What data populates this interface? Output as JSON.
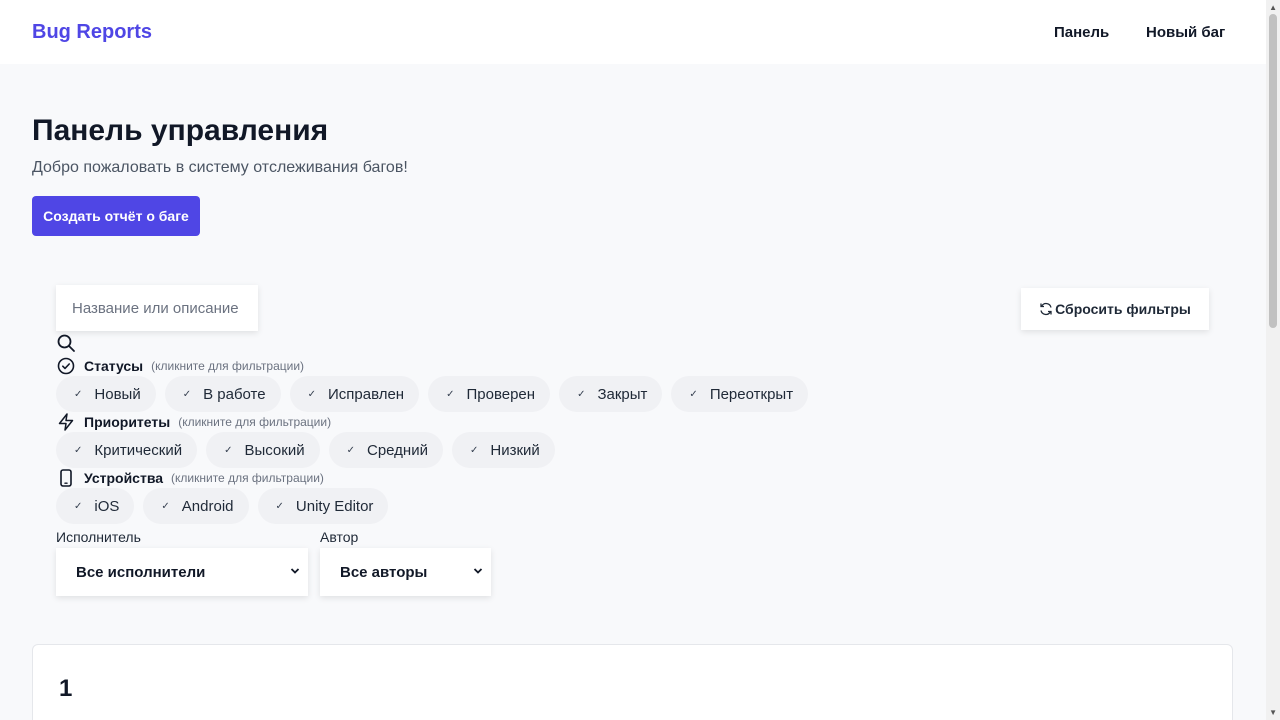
{
  "header": {
    "brand": "Bug Reports",
    "nav": {
      "dashboard": "Панель",
      "new_bug": "Новый баг"
    }
  },
  "main": {
    "title": "Панель управления",
    "subtitle": "Добро пожаловать в систему отслеживания багов!",
    "create_button": "Создать отчёт о баге"
  },
  "filters": {
    "search_placeholder": "Название или описание",
    "search_value": "",
    "reset_label": "Сбросить фильтры",
    "statuses": {
      "title": "Статусы",
      "hint": "(кликните для фильтрации)",
      "items": [
        "Новый",
        "В работе",
        "Исправлен",
        "Проверен",
        "Закрыт",
        "Переоткрыт"
      ]
    },
    "priorities": {
      "title": "Приоритеты",
      "hint": "(кликните для фильтрации)",
      "items": [
        "Критический",
        "Высокий",
        "Средний",
        "Низкий"
      ]
    },
    "devices": {
      "title": "Устройства",
      "hint": "(кликните для фильтрации)",
      "items": [
        "iOS",
        "Android",
        "Unity Editor"
      ]
    },
    "assignee": {
      "label": "Исполнитель",
      "value": "Все исполнители"
    },
    "author": {
      "label": "Автор",
      "value": "Все авторы"
    }
  },
  "stats_card": {
    "value": "1"
  },
  "colors": {
    "accent": "#4f46e5",
    "background": "#f8f9fb",
    "chip": "#f0f1f4"
  }
}
